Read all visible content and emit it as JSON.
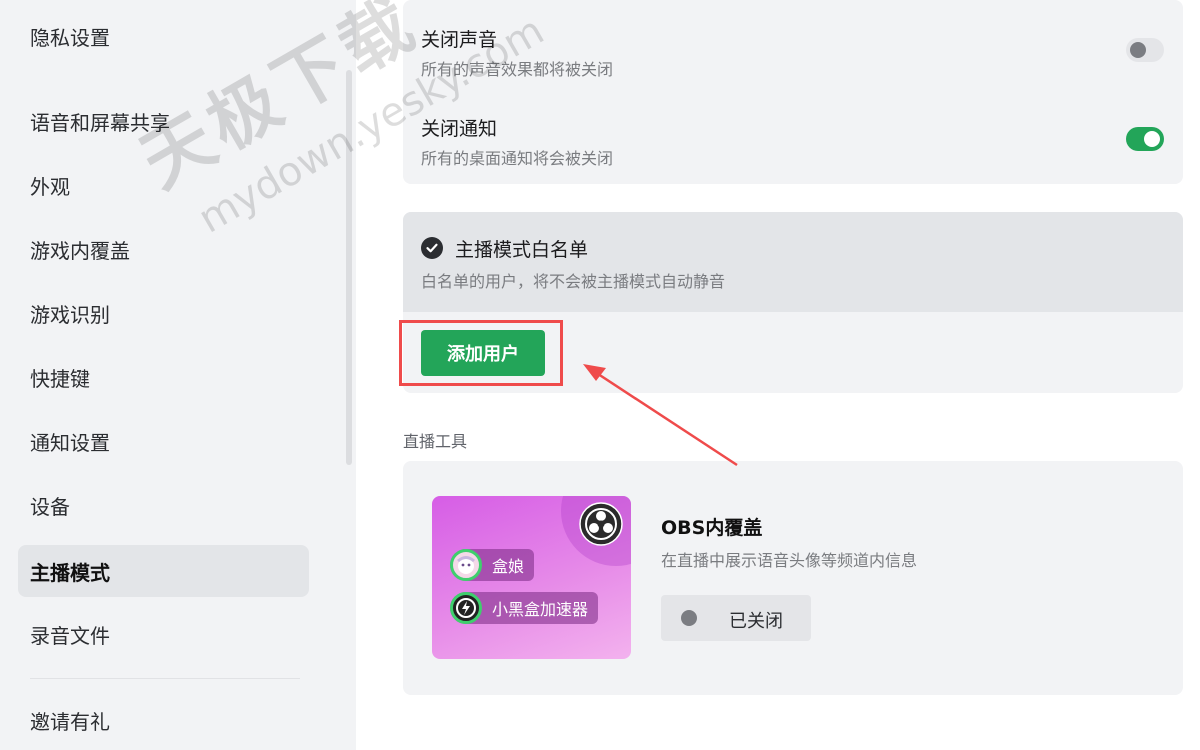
{
  "sidebar": {
    "items": [
      {
        "label": "隐私设置",
        "active": false
      },
      {
        "label": "语音和屏幕共享",
        "active": false
      },
      {
        "label": "外观",
        "active": false
      },
      {
        "label": "游戏内覆盖",
        "active": false
      },
      {
        "label": "游戏识别",
        "active": false
      },
      {
        "label": "快捷键",
        "active": false
      },
      {
        "label": "通知设置",
        "active": false
      },
      {
        "label": "设备",
        "active": false
      },
      {
        "label": "主播模式",
        "active": true
      },
      {
        "label": "录音文件",
        "active": false
      },
      {
        "label": "邀请有礼",
        "active": false
      }
    ]
  },
  "settings": {
    "mute_sound": {
      "title": "关闭声音",
      "desc": "所有的声音效果都将被关闭",
      "enabled": false
    },
    "mute_notify": {
      "title": "关闭通知",
      "desc": "所有的桌面通知将会被关闭",
      "enabled": true
    }
  },
  "whitelist": {
    "title": "主播模式白名单",
    "desc": "白名单的用户，将不会被主播模式自动静音",
    "add_button": "添加用户"
  },
  "tools": {
    "section_label": "直播工具",
    "obs": {
      "title": "OBS内覆盖",
      "desc": "在直播中展示语音头像等频道内信息",
      "status": "已关闭",
      "enabled": false,
      "preview_users": [
        "盒娘",
        "小黑盒加速器"
      ]
    }
  },
  "watermark": {
    "line1": "天极下载",
    "line2": "mydown.yesky.com"
  },
  "colors": {
    "accent_green": "#23a559",
    "highlight_red": "#ef4b4b",
    "sidebar_bg": "#f2f3f5"
  },
  "icons": [
    "check-circle-icon",
    "obs-logo-icon",
    "avatar-icon",
    "lightning-icon",
    "toggle-knob"
  ]
}
